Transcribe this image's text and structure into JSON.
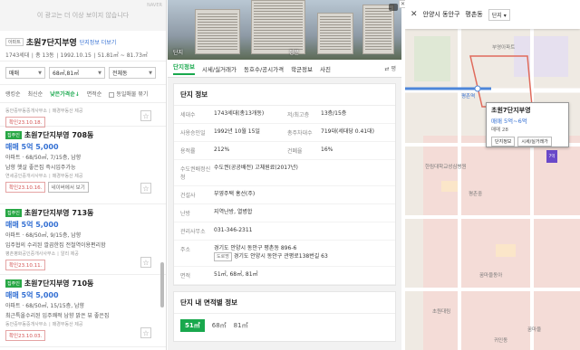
{
  "ad": {
    "text": "이 광고는 더 이상 보이지 않습니다",
    "tag": "NAVER"
  },
  "complex": {
    "type_tag": "아파트",
    "name": "초원7단지부영",
    "info_link": "단지정보 더보기",
    "meta": "1743세대 ∣ 총 13동 ∣ 1992.10.15 ∣ 51.81㎡ ~ 81.73㎡"
  },
  "filters": {
    "trade": "매매",
    "area": "68㎡,81㎡",
    "building": "전체동"
  },
  "sort": {
    "items": [
      "랭킹순",
      "최신순",
      "낮은가격순↓",
      "면적순"
    ],
    "active_index": 2,
    "same_group_label": "동일매물 묶기"
  },
  "listings": [
    {
      "partial": true,
      "agent": "동안중부동중개사무소 ∣ 매경부동산 제공",
      "confirm": "확인23.10.18."
    },
    {
      "verify": "집주인",
      "title": "초원7단지부영 708동",
      "price": "매매 5억 5,000",
      "desc1": "아파트 · 68/50㎡, 7/15층, 남향",
      "desc2": "남향 햇살 좋은집 즉시입주가능",
      "agent": "연세공인중개사사무소 ∣ 매경부동산 제공",
      "confirm": "확인23.10.16.",
      "extra": "네이버에서 보기"
    },
    {
      "verify": "집주인",
      "title": "초원7단지부영 713동",
      "price": "매매 5억 5,000",
      "desc1": "아파트 · 68/50㎡, 9/15층, 남향",
      "desc2": "입주협의 수리된 깔끔한집 전철역이용편리함",
      "agent": "평촌평화공인중개사사무소 ∣ 알리 제공",
      "confirm": "확인23.10.11."
    },
    {
      "verify": "집주인",
      "title": "초원7단지부영 710동",
      "price": "매매 5억 5,000",
      "desc1": "아파트 · 68/50㎡, 15/15층, 남향",
      "desc2": "최근특올수리된 입주쾌적 남향 맑은 뷰 좋은집",
      "agent": "동안중부동중개사무소 ∣ 매경부동산 제공",
      "confirm": "확인23.10.03."
    }
  ],
  "photo": {
    "label_left": "단지",
    "label_right": "정문"
  },
  "tabs": [
    "단지정보",
    "시세/실거래가",
    "동호수/공시가격",
    "학군정보",
    "사진"
  ],
  "tabs_more": "평",
  "detail": {
    "section_title": "단지 정보",
    "rows": [
      {
        "k1": "세대수",
        "v1": "1743세대(총13개동)",
        "k2": "저/최고층",
        "v2": "13층/15층"
      },
      {
        "k1": "사용승인일",
        "v1": "1992년 10월 15일",
        "k2": "총주차대수",
        "v2": "719대(세대당 0.41대)"
      },
      {
        "k1": "용적률",
        "v1": "212%",
        "k2": "건폐율",
        "v2": "16%"
      },
      {
        "k1": "수도권배정신청",
        "v1": "수도권(공공배전) 고체원료(2017년)",
        "k2": "",
        "v2": ""
      }
    ],
    "builder_label": "건설사",
    "builder": "부영주택 홍선(주)",
    "heat_label": "난방",
    "heat": "지역난방, 열병합",
    "tel_label": "관리사무소",
    "tel": "031-346-2311",
    "addr_label": "주소",
    "addr1": "경기도 안양시 동안구 평촌동 896-6",
    "road_tag": "도로명",
    "addr2": "경기도 안양시 동안구 관평로138번길 63",
    "area_label": "면적",
    "area_val": "51㎡, 68㎡, 81㎡"
  },
  "area_section": {
    "title": "단지 내 면적별 정보",
    "tabs": [
      "51㎡",
      "68㎡",
      "81㎡"
    ],
    "active_index": 0
  },
  "map": {
    "breadcrumb": [
      "안양시 동안구",
      "평촌동",
      "단지"
    ],
    "close": "✕",
    "popup": {
      "title": "초원7단지부영",
      "price": "매매 5억~6억",
      "count": "매매 28",
      "btn1": "단지정보",
      "btn2": "시세/실거래가"
    },
    "labels": [
      "평촌역",
      "부영아파트",
      "꿈마을",
      "귀인동",
      "한림대학교성심병원",
      "평촌중",
      "꿈마을동아",
      "초원대림"
    ]
  }
}
